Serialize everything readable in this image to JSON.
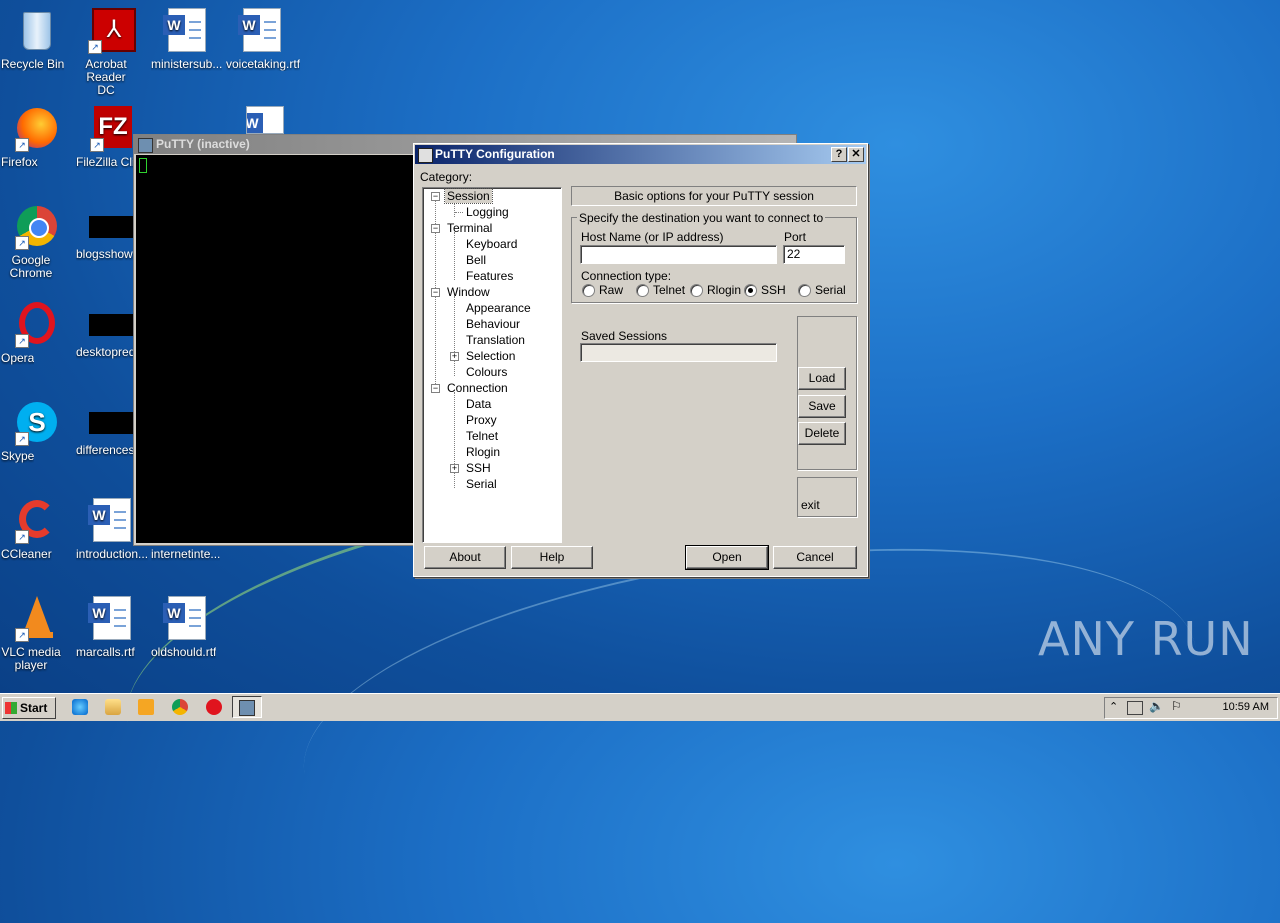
{
  "desktop_icons": [
    {
      "label": "Recycle Bin"
    },
    {
      "label": "Acrobat Reader DC"
    },
    {
      "label": "ministersub..."
    },
    {
      "label": "voicetaking.rtf"
    },
    {
      "label": "Firefox"
    },
    {
      "label": "FileZilla Clie"
    },
    {
      "label": "Google Chrome"
    },
    {
      "label": "blogsshow.r"
    },
    {
      "label": "Opera"
    },
    {
      "label": "desktopred"
    },
    {
      "label": "Skype"
    },
    {
      "label": "differences"
    },
    {
      "label": "CCleaner"
    },
    {
      "label": "introduction..."
    },
    {
      "label": "internetinte..."
    },
    {
      "label": "VLC media player"
    },
    {
      "label": "marcalls.rtf"
    },
    {
      "label": "oldshould.rtf"
    }
  ],
  "terminal": {
    "title": "PuTTY (inactive)"
  },
  "dialog": {
    "title": "PuTTY Configuration",
    "help_btn": "?",
    "close_btn": "✕",
    "category_label": "Category:",
    "tree": [
      "Session",
      "Logging",
      "Terminal",
      "Keyboard",
      "Bell",
      "Features",
      "Window",
      "Appearance",
      "Behaviour",
      "Translation",
      "Selection",
      "Colours",
      "Connection",
      "Data",
      "Proxy",
      "Telnet",
      "Rlogin",
      "SSH",
      "Serial"
    ],
    "panel_header": "Basic options for your PuTTY session",
    "dest_group": "Specify the destination you want to connect to",
    "host_label": "Host Name (or IP address)",
    "host_value": "",
    "port_label": "Port",
    "port_value": "22",
    "conn_type_label": "Connection type:",
    "conn_types": [
      "Raw",
      "Telnet",
      "Rlogin",
      "SSH",
      "Serial"
    ],
    "selected_conn_type": "SSH",
    "saved_sessions_label": "Saved Sessions",
    "saved_session_value": "",
    "load": "Load",
    "save": "Save",
    "delete": "Delete",
    "exit_label": "exit",
    "about": "About",
    "help": "Help",
    "open": "Open",
    "cancel": "Cancel"
  },
  "taskbar": {
    "start": "Start",
    "clock": "10:59 AM"
  },
  "watermark": "ANY RUN"
}
